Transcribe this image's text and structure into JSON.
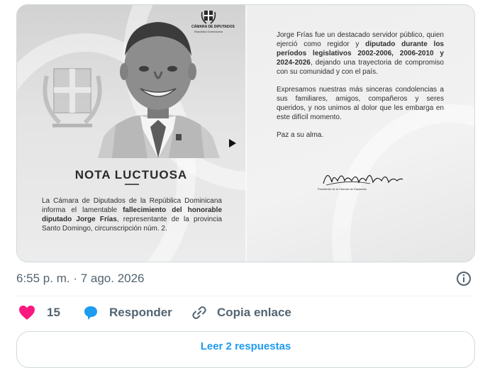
{
  "post_image": {
    "logo": {
      "name": "CÁMARA DE DIPUTADOS",
      "sub": "República Dominicana"
    },
    "heading": "NOTA LUCTUOSA",
    "intro": {
      "part1": "La Cámara de Diputados de la República Dominicana informa el lamentable ",
      "bold": "fallecimiento del honorable diputado Jorge Frías",
      "part2": ", representante de la provincia Santo Domingo, circunscripción núm. 2."
    },
    "paragraph1": {
      "part1": "Jorge Frías fue un destacado servidor público, quien ejerció como regidor y ",
      "bold": "diputado durante los períodos legislativos 2002-2006, 2006-2010 y 2024-2026",
      "part2": ", dejando una trayectoria de compromiso con su comunidad y con el país."
    },
    "paragraph2": "Expresamos nuestras más sinceras condolencias a sus familiares, amigos, compañeros y seres queridos, y nos unimos al dolor que les embarga en este difícil momento.",
    "paragraph3": "Paz a su alma.",
    "signature": "Alfredo Pacheco Osoria",
    "signature_caption": "Presidente de la Cámara de Diputados"
  },
  "tweet": {
    "timestamp": "6:55 p. m. · 7 ago. 2026",
    "likes": "15",
    "reply_label": "Responder",
    "copy_label": "Copia enlace",
    "more_label": "Leer 2 respuestas"
  },
  "colors": {
    "like": "#f91880",
    "reply": "#1d9bf0",
    "muted": "#536471"
  },
  "icons": [
    "play-icon",
    "info-icon",
    "heart-icon",
    "reply-bubble-icon",
    "link-icon"
  ]
}
